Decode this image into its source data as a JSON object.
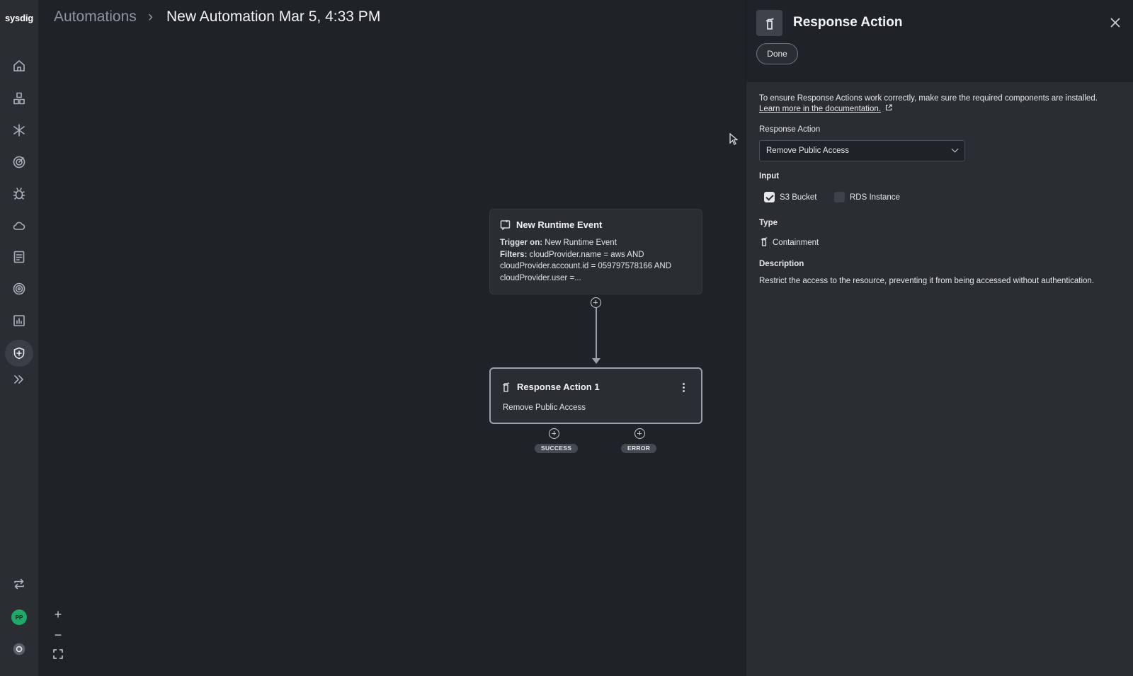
{
  "app": {
    "logo": "sysdig"
  },
  "header": {
    "breadcrumb_root": "Automations",
    "breadcrumb_sep": "›",
    "title": "New Automation Mar 5, 4:33 PM"
  },
  "nav": {
    "items": [
      {
        "icon": "home-icon"
      },
      {
        "icon": "inventory-icon"
      },
      {
        "icon": "integrations-icon"
      },
      {
        "icon": "threats-icon"
      },
      {
        "icon": "vulnerabilities-icon"
      },
      {
        "icon": "cloud-icon"
      },
      {
        "icon": "compliance-icon"
      },
      {
        "icon": "identity-icon"
      },
      {
        "icon": "reports-icon"
      },
      {
        "icon": "response-icon"
      },
      {
        "icon": "expand-icon"
      }
    ],
    "avatar": "PP"
  },
  "canvas": {
    "zoom_in": "+",
    "zoom_out": "−",
    "trigger_node": {
      "title": "New Runtime Event",
      "trigger_label": "Trigger on:",
      "trigger_value": "New Runtime Event",
      "filters_label": "Filters:",
      "filters_value": "cloudProvider.name = aws AND cloudProvider.account.id = 059797578166 AND cloudProvider.user =..."
    },
    "action_node": {
      "title": "Response Action 1",
      "subtitle": "Remove Public Access"
    },
    "branches": {
      "success": "SUCCESS",
      "error": "ERROR"
    }
  },
  "panel": {
    "title": "Response Action",
    "done_label": "Done",
    "info_text": "To ensure Response Actions work correctly, make sure the required components are installed.",
    "info_link": "Learn more in the documentation.",
    "response_action_label": "Response Action",
    "response_action_value": "Remove Public Access",
    "input_label": "Input",
    "inputs": [
      {
        "label": "S3 Bucket",
        "checked": true
      },
      {
        "label": "RDS Instance",
        "checked": false
      }
    ],
    "type_label": "Type",
    "type_value": "Containment",
    "description_label": "Description",
    "description_value": "Restrict the access to the resource, preventing it from being accessed without authentication."
  }
}
